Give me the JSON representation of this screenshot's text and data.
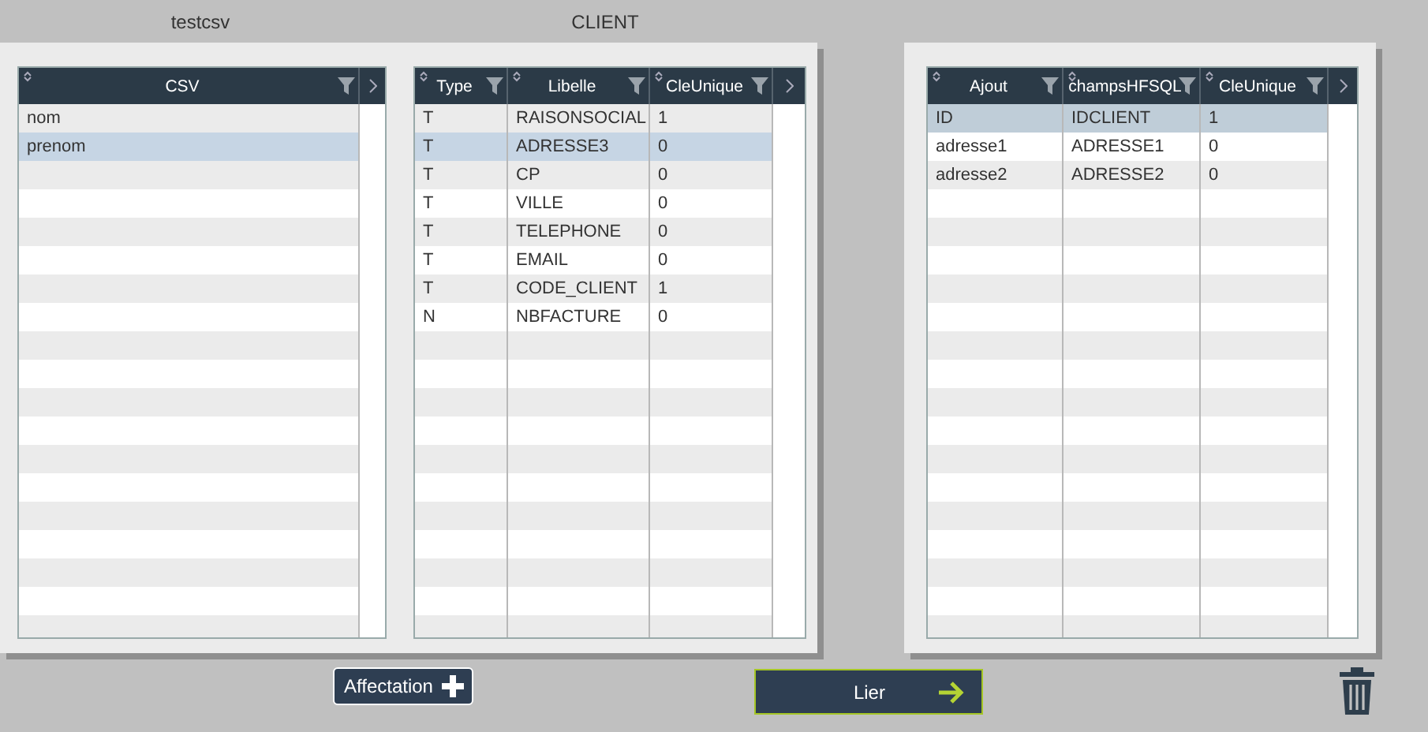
{
  "tables": [
    {
      "title": "testcsv",
      "columns": [
        "CSV"
      ],
      "rows": [
        {
          "cells": [
            "nom"
          ],
          "selected": false
        },
        {
          "cells": [
            "prenom"
          ],
          "selected": true
        }
      ]
    },
    {
      "title": "CLIENT",
      "columns": [
        "Type",
        "Libelle",
        "CleUnique"
      ],
      "rows": [
        {
          "cells": [
            "T",
            "RAISONSOCIAL",
            "1"
          ],
          "selected": false
        },
        {
          "cells": [
            "T",
            "ADRESSE3",
            "0"
          ],
          "selected": true
        },
        {
          "cells": [
            "T",
            "CP",
            "0"
          ],
          "selected": false
        },
        {
          "cells": [
            "T",
            "VILLE",
            "0"
          ],
          "selected": false
        },
        {
          "cells": [
            "T",
            "TELEPHONE",
            "0"
          ],
          "selected": false
        },
        {
          "cells": [
            "T",
            "EMAIL",
            "0"
          ],
          "selected": false
        },
        {
          "cells": [
            "T",
            "CODE_CLIENT",
            "1"
          ],
          "selected": false
        },
        {
          "cells": [
            "N",
            "NBFACTURE",
            "0"
          ],
          "selected": false
        }
      ]
    },
    {
      "columns": [
        "Ajout",
        "champsHFSQL",
        "CleUnique"
      ],
      "rows": [
        {
          "cells": [
            "ID",
            "IDCLIENT",
            "1"
          ],
          "selected": true
        },
        {
          "cells": [
            "adresse1",
            "ADRESSE1",
            "0"
          ],
          "selected": false
        },
        {
          "cells": [
            "adresse2",
            "ADRESSE2",
            "0"
          ],
          "selected": false
        }
      ]
    }
  ],
  "buttons": {
    "affectation": "Affectation",
    "lier": "Lier"
  }
}
